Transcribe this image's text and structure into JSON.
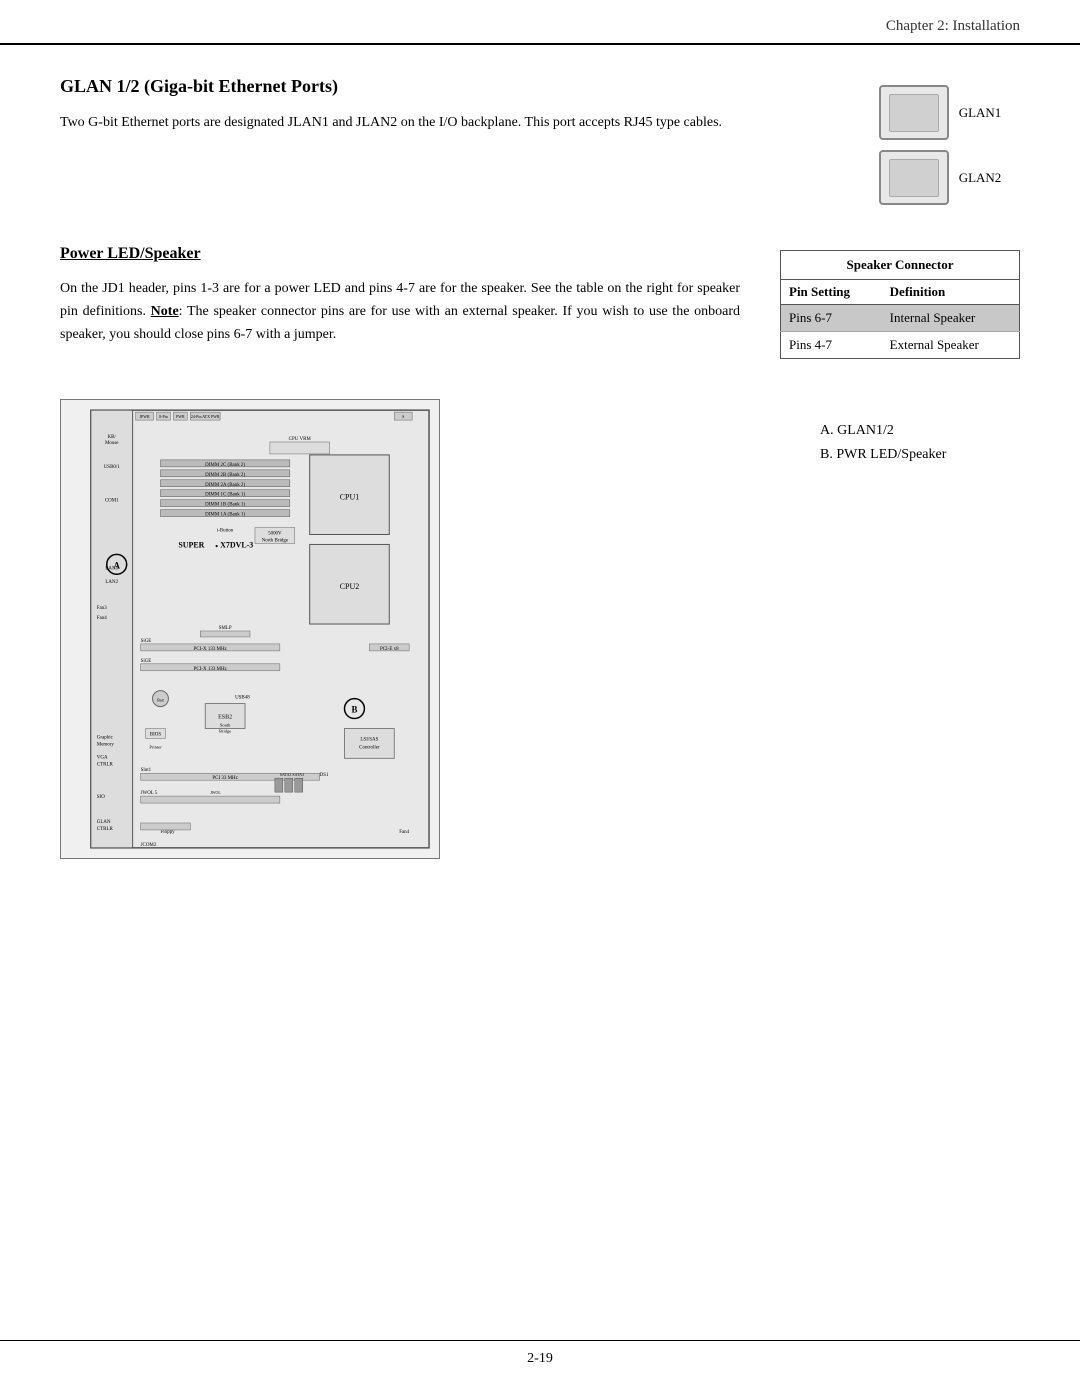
{
  "header": {
    "title": "Chapter 2: Installation"
  },
  "footer": {
    "page_number": "2-19"
  },
  "glan_section": {
    "title": "GLAN 1/2 (Giga-bit Ethernet Ports)",
    "body": "Two G-bit Ethernet ports are  designated JLAN1 and JLAN2 on the I/O backplane. This port accepts RJ45 type cables.",
    "port1_label": "GLAN1",
    "port2_label": "GLAN2"
  },
  "power_section": {
    "title": "Power LED/Speaker",
    "body_parts": [
      "On the JD1 header, pins 1-3  are for a power LED and pins 4-7 are for the speaker. See the table on the right for speaker pin definitions. ",
      "Note",
      ": The speaker connector pins are for use with an external speaker.  If you wish to use the onboard speaker, you should close pins 6-7 with a jumper."
    ]
  },
  "speaker_table": {
    "title": "Speaker Connector",
    "col1": "Pin Setting",
    "col2": "Definition",
    "rows": [
      {
        "pins": "Pins 6-7",
        "definition": "Internal Speaker",
        "highlighted": true
      },
      {
        "pins": "Pins 4-7",
        "definition": "External Speaker",
        "highlighted": false
      }
    ]
  },
  "diagram_labels": {
    "label_a": "A. GLAN1/2",
    "label_b": "B. PWR LED/Speaker"
  }
}
